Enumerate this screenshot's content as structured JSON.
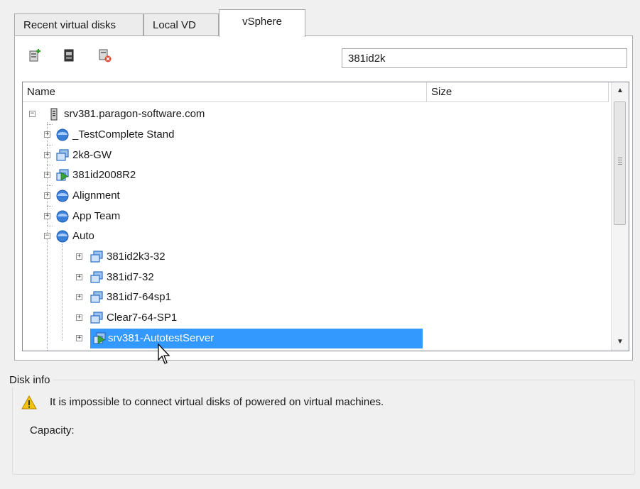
{
  "tabs": [
    {
      "label": "Recent virtual disks"
    },
    {
      "label": "Local VD"
    },
    {
      "label": "vSphere"
    }
  ],
  "toolbar": {
    "buttons": [
      "add-disk-icon",
      "disk-icon",
      "remove-disk-icon"
    ],
    "search_value": "381id2k"
  },
  "tree": {
    "columns": {
      "name": "Name",
      "size": "Size"
    },
    "rows": [
      {
        "label": "srv381.paragon-software.com",
        "icon": "server-icon",
        "expanded": true
      },
      {
        "label": "_TestComplete Stand",
        "icon": "resource-pool-icon",
        "expanded": false
      },
      {
        "label": "2k8-GW",
        "icon": "vm-icon",
        "expanded": false
      },
      {
        "label": "381id2008R2",
        "icon": "vm-powered-on-icon",
        "expanded": false
      },
      {
        "label": "Alignment",
        "icon": "resource-pool-icon",
        "expanded": false
      },
      {
        "label": "App Team",
        "icon": "resource-pool-icon",
        "expanded": false
      },
      {
        "label": "Auto",
        "icon": "resource-pool-icon",
        "expanded": true
      },
      {
        "label": "381id2k3-32",
        "icon": "vm-icon",
        "expanded": false
      },
      {
        "label": "381id7-32",
        "icon": "vm-icon",
        "expanded": false
      },
      {
        "label": "381id7-64sp1",
        "icon": "vm-icon",
        "expanded": false
      },
      {
        "label": "Clear7-64-SP1",
        "icon": "vm-icon",
        "expanded": false
      },
      {
        "label": "srv381-AutotestServer",
        "icon": "vm-powered-on-icon",
        "expanded": false,
        "selected": true
      }
    ]
  },
  "disk_info": {
    "title": "Disk info",
    "warning": "It is impossible to connect virtual disks of powered on virtual machines.",
    "capacity_label": "Capacity:"
  },
  "colors": {
    "selection": "#3399ff",
    "background": "#f0f0f0",
    "pool_blue": "#2f74d0",
    "vm_green": "#3aa53a",
    "warning": "#f4c20d"
  }
}
